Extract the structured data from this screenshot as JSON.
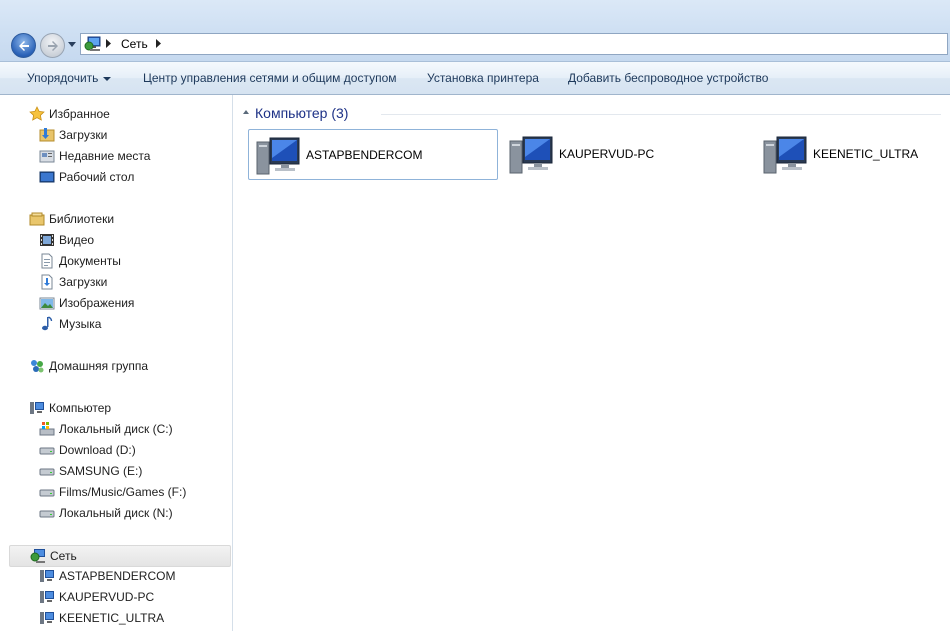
{
  "address": {
    "breadcrumb": "Сеть"
  },
  "toolbar": {
    "organize": "Упорядочить",
    "network_center": "Центр управления сетями и общим доступом",
    "add_printer": "Установка принтера",
    "add_wireless": "Добавить беспроводное устройство"
  },
  "nav": {
    "favorites": {
      "label": "Избранное",
      "items": [
        {
          "label": "Загрузки",
          "icon": "downloads-folder-icon"
        },
        {
          "label": "Недавние места",
          "icon": "recent-places-icon"
        },
        {
          "label": "Рабочий стол",
          "icon": "desktop-icon"
        }
      ]
    },
    "libraries": {
      "label": "Библиотеки",
      "items": [
        {
          "label": "Видео",
          "icon": "video-icon"
        },
        {
          "label": "Документы",
          "icon": "documents-icon"
        },
        {
          "label": "Загрузки",
          "icon": "downloads-icon"
        },
        {
          "label": "Изображения",
          "icon": "pictures-icon"
        },
        {
          "label": "Музыка",
          "icon": "music-icon"
        }
      ]
    },
    "homegroup": {
      "label": "Домашняя группа"
    },
    "computer": {
      "label": "Компьютер",
      "items": [
        {
          "label": "Локальный диск (C:)",
          "icon": "system-drive-icon"
        },
        {
          "label": "Download (D:)",
          "icon": "drive-icon"
        },
        {
          "label": " SAMSUNG (E:)",
          "icon": "drive-icon"
        },
        {
          "label": "Films/Music/Games (F:)",
          "icon": "drive-icon"
        },
        {
          "label": "Локальный диск (N:)",
          "icon": "drive-icon"
        }
      ]
    },
    "network": {
      "label": "Сеть",
      "items": [
        {
          "label": "ASTAPBENDERCOM",
          "icon": "computer-icon"
        },
        {
          "label": "KAUPERVUD-PC",
          "icon": "computer-icon"
        },
        {
          "label": "KEENETIC_ULTRA",
          "icon": "computer-icon"
        }
      ]
    }
  },
  "content": {
    "group_title": "Компьютер (3)",
    "computers": [
      {
        "name": "ASTAPBENDERCOM"
      },
      {
        "name": "KAUPERVUD-PC"
      },
      {
        "name": "KEENETIC_ULTRA"
      }
    ]
  }
}
